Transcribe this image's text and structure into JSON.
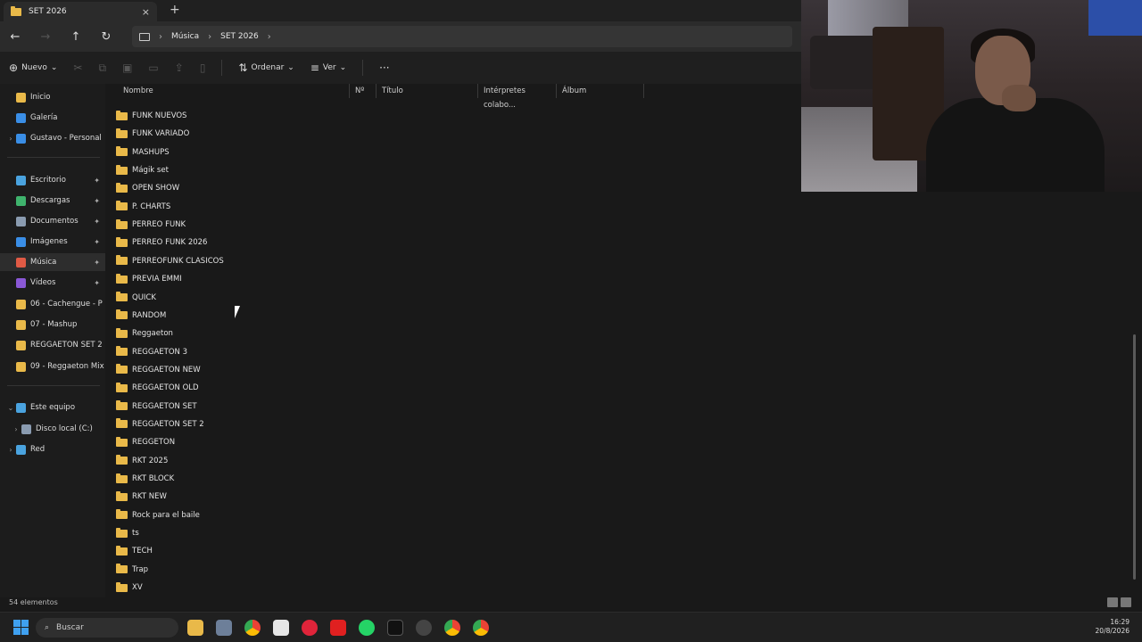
{
  "tab": {
    "title": "SET 2026",
    "close": "×",
    "new": "+"
  },
  "nav": {
    "back": "←",
    "forward": "→",
    "up": "↑",
    "refresh": "↻"
  },
  "breadcrumb": [
    "Música",
    "SET 2026"
  ],
  "commands": {
    "new": "Nuevo",
    "sort": "Ordenar",
    "view": "Ver",
    "more": "···"
  },
  "sidebar": {
    "items": [
      {
        "label": "Inicio",
        "color": "#e9b949"
      },
      {
        "label": "Galería",
        "color": "#3a8ee6"
      },
      {
        "label": "Gustavo - Personal",
        "color": "#3a8ee6"
      },
      {
        "label": "Escritorio",
        "color": "#4aa3df"
      },
      {
        "label": "Descargas",
        "color": "#3fb36d"
      },
      {
        "label": "Documentos",
        "color": "#8a9bb0"
      },
      {
        "label": "Imágenes",
        "color": "#3a8ee6"
      },
      {
        "label": "Música",
        "color": "#e05a45"
      },
      {
        "label": "Vídeos",
        "color": "#8a58d6"
      },
      {
        "label": "06 - Cachengue - P",
        "color": "#e9b949"
      },
      {
        "label": "07 - Mashup",
        "color": "#e9b949"
      },
      {
        "label": "REGGAETON SET 2",
        "color": "#e9b949"
      },
      {
        "label": "09 - Reggaeton Mix",
        "color": "#e9b949"
      },
      {
        "label": "Este equipo",
        "color": "#4aa3df"
      },
      {
        "label": "Disco local (C:)",
        "color": "#8a9bb0"
      },
      {
        "label": "Red",
        "color": "#4aa3df"
      }
    ]
  },
  "columns": {
    "name": "Nombre",
    "num": "Nº",
    "title": "Título",
    "artists": "Intérpretes colabo...",
    "album": "Álbum"
  },
  "files": [
    "FUNK NUEVOS",
    "FUNK VARIADO",
    "MASHUPS",
    "Mágik set",
    "OPEN SHOW",
    "P. CHARTS",
    "PERREO FUNK",
    "PERREO FUNK 2026",
    "PERREOFUNK CLASICOS",
    "PREVIA EMMI",
    "QUICK",
    "RANDOM",
    "Reggaeton",
    "REGGAETON 3",
    "REGGAETON NEW",
    "REGGAETON OLD",
    "REGGAETON SET",
    "REGGAETON SET 2",
    "REGGETON",
    "RKT 2025",
    "RKT BLOCK",
    "RKT NEW",
    "Rock para el baile",
    "ts",
    "TECH",
    "Trap",
    "XV"
  ],
  "status": {
    "count": "54 elementos"
  },
  "taskbar": {
    "search": "Buscar",
    "time": "16:29",
    "date": "20/8/2026"
  }
}
